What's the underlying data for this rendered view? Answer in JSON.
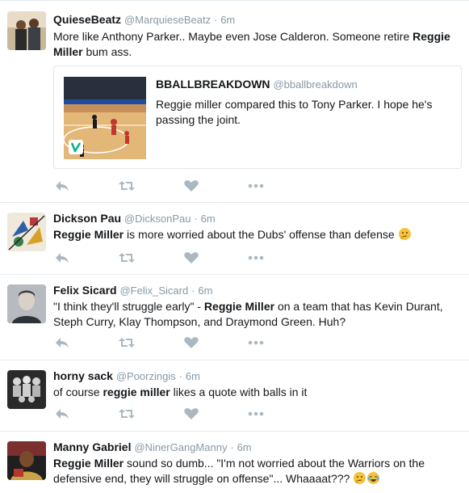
{
  "tweets": [
    {
      "name": "QuieseBeatz",
      "handle": "@MarquieseBeatz",
      "dot": "·",
      "time": "6m",
      "text_parts": [
        "More like Anthony Parker.. Maybe even Jose Calderon. Someone retire ",
        "Reggie Miller",
        " bum ass."
      ],
      "quote": {
        "name": "BBALLBREAKDOWN",
        "handle": "@bballbreakdown",
        "text": "Reggie miller compared this to Tony Parker. I hope he's passing the joint."
      }
    },
    {
      "name": "Dickson Pau",
      "handle": "@DicksonPau",
      "dot": "·",
      "time": "6m",
      "text_parts": [
        "Reggie Miller",
        " is more worried about the Dubs' offense than defense "
      ]
    },
    {
      "name": "Felix Sicard",
      "handle": "@Felix_Sicard",
      "dot": "·",
      "time": "6m",
      "text_parts": [
        "\"I think they'll struggle early\" - ",
        "Reggie Miller",
        " on a team that has Kevin Durant, Steph Curry, Klay Thompson, and Draymond Green. Huh?"
      ]
    },
    {
      "name": "horny sack",
      "handle": "@Poorzingis",
      "dot": "·",
      "time": "6m",
      "text_parts": [
        "of course ",
        "reggie miller",
        " likes a quote with balls in it"
      ]
    },
    {
      "name": "Manny Gabriel",
      "handle": "@NinerGangManny",
      "dot": "·",
      "time": "6m",
      "text_parts": [
        "Reggie Miller",
        " sound so dumb... \"I'm not worried about the Warriors on the defensive end, they will struggle on offense\"... Whaaaat??? "
      ]
    }
  ],
  "colors": {
    "action_icon": "#aab8c2",
    "secondary_text": "#8899a6",
    "divider": "#e6ecf0"
  },
  "icons": {
    "reply": "reply-icon",
    "retweet": "retweet-icon",
    "like": "heart-icon",
    "more": "more-icon",
    "vine": "vine-logo-icon",
    "thinking": "thinking-face-emoji",
    "laughing": "tears-of-joy-emoji"
  }
}
